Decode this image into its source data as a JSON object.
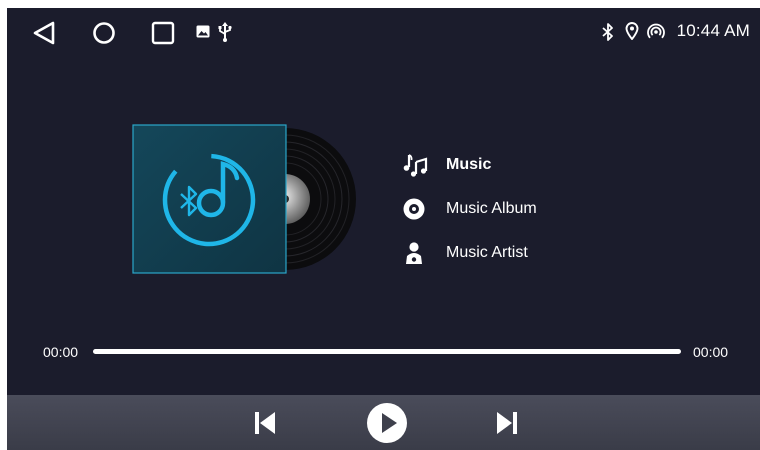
{
  "status_bar": {
    "nav_icons": [
      "back-icon",
      "home-icon",
      "recents-icon"
    ],
    "notification_icons": [
      "image-icon",
      "usb-icon"
    ],
    "system_icons": [
      "bluetooth-icon",
      "location-icon",
      "hotspot-icon"
    ],
    "time": "10:44 AM"
  },
  "album_art": {
    "icon": "bluetooth-music-icon",
    "accent_color": "#1fb6e8"
  },
  "menu": {
    "items": [
      {
        "label": "Music",
        "icon": "music-notes-icon",
        "active": true
      },
      {
        "label": "Music Album",
        "icon": "album-disc-icon",
        "active": false
      },
      {
        "label": "Music Artist",
        "icon": "artist-icon",
        "active": false
      }
    ]
  },
  "playback": {
    "current_time": "00:00",
    "total_time": "00:00",
    "progress": 0
  },
  "controls": {
    "icons": [
      "previous-track-icon",
      "play-icon",
      "next-track-icon"
    ]
  },
  "colors": {
    "background": "#1b1c2c",
    "control_bar": "#42444f",
    "text": "#ffffff"
  }
}
